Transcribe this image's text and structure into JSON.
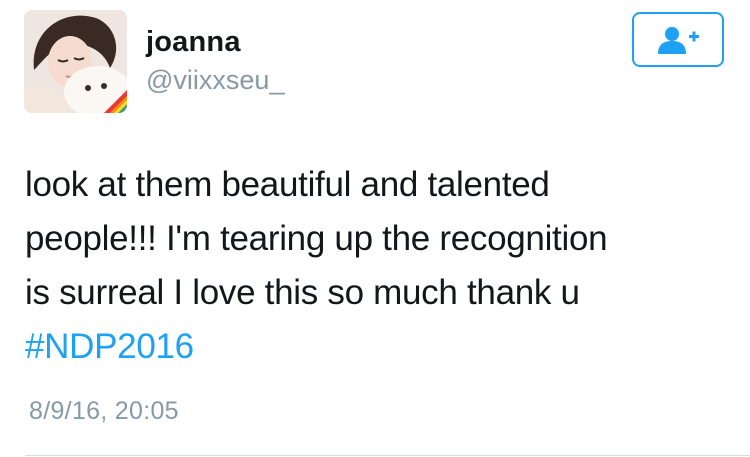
{
  "user": {
    "display_name": "joanna",
    "handle": "@viixxseu_"
  },
  "follow_button": {
    "icon": "add-user-icon",
    "accent_color": "#1da1f2"
  },
  "tweet": {
    "text_lines": [
      "look at them beautiful and talented",
      "people!!! I'm tearing up the recognition",
      "is surreal I love this so much thank u"
    ],
    "hashtag": "#NDP2016",
    "timestamp": "8/9/16, 20:05"
  },
  "colors": {
    "text": "#14171a",
    "secondary": "#8899a6",
    "link": "#1da1f2",
    "divider": "#d7dde2"
  }
}
